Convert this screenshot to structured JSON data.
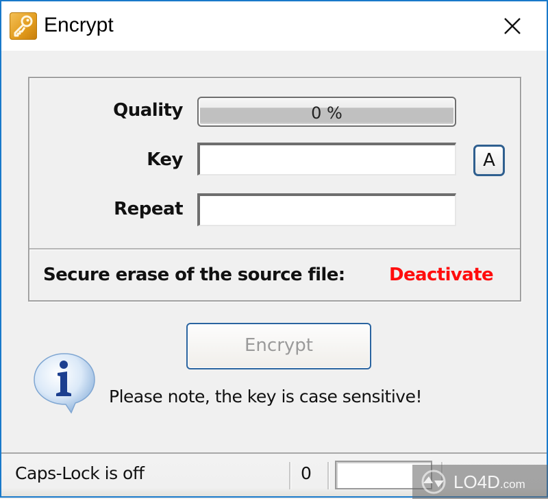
{
  "window": {
    "title": "Encrypt",
    "icon": "key-icon",
    "close_icon": "close-icon",
    "border_color": "#1979ca"
  },
  "form": {
    "quality_label": "Quality",
    "quality_value_percent": 0,
    "quality_text": "0 %",
    "key_label": "Key",
    "key_value": "",
    "repeat_label": "Repeat",
    "repeat_value": "",
    "keyboard_button_label": "A",
    "secure_erase_label": "Secure erase of the source file:",
    "secure_erase_link": "Deactivate",
    "link_color": "#ff0d0d"
  },
  "actions": {
    "encrypt_label": "Encrypt",
    "encrypt_enabled": false
  },
  "info": {
    "icon": "info-icon",
    "note": "Please note, the key is case sensitive!"
  },
  "status": {
    "caps_lock": "Caps-Lock is off",
    "count": "0",
    "box_value": ""
  },
  "watermark": {
    "brand": "LO4D",
    "suffix": ".com"
  }
}
